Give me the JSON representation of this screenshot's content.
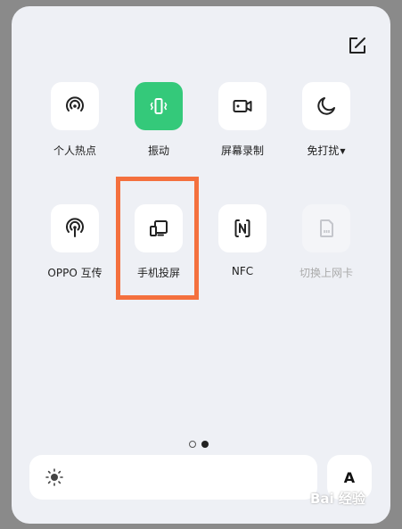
{
  "tiles": {
    "hotspot": {
      "label": "个人热点"
    },
    "vibrate": {
      "label": "振动"
    },
    "record": {
      "label": "屏幕录制"
    },
    "dnd": {
      "label": "免打扰"
    },
    "oppo": {
      "label": "OPPO 互传"
    },
    "cast": {
      "label": "手机投屏"
    },
    "nfc": {
      "label": "NFC"
    },
    "sim": {
      "label": "切换上网卡"
    }
  },
  "pagination": {
    "current": 2,
    "total": 2
  },
  "font_button": {
    "label": "A"
  },
  "watermark": {
    "text": "Bai 经验"
  },
  "colors": {
    "active": "#34c97a",
    "highlight": "#f4703e",
    "panel": "#eef0f5"
  }
}
